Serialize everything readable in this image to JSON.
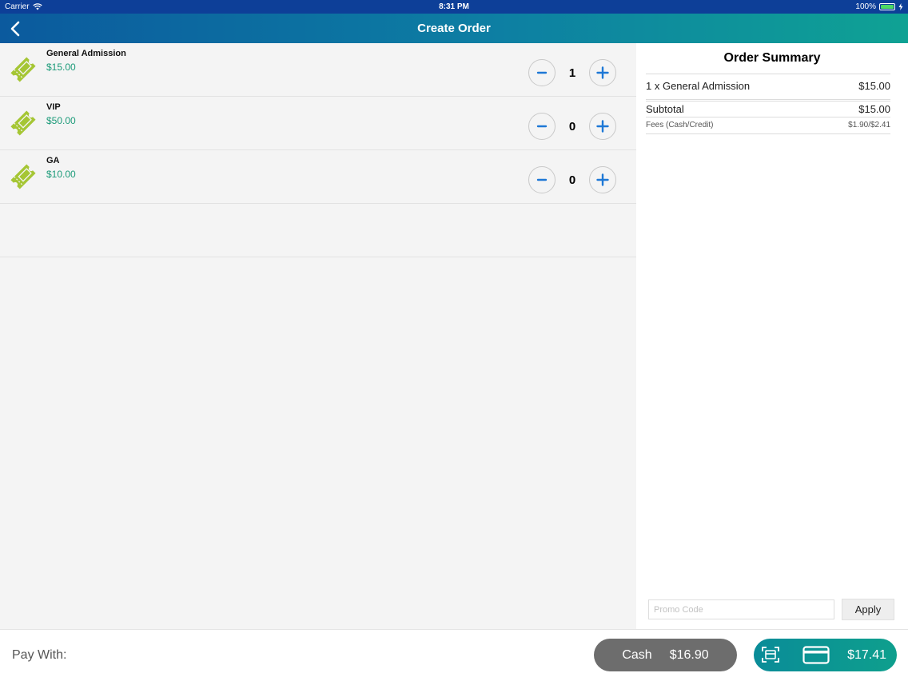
{
  "status_bar": {
    "carrier": "Carrier",
    "time": "8:31 PM",
    "battery": "100%"
  },
  "nav": {
    "title": "Create Order"
  },
  "tickets": [
    {
      "name": "General Admission",
      "price": "$15.00",
      "quantity": "1"
    },
    {
      "name": "VIP",
      "price": "$50.00",
      "quantity": "0"
    },
    {
      "name": "GA",
      "price": "$10.00",
      "quantity": "0"
    }
  ],
  "summary": {
    "title": "Order Summary",
    "items": [
      {
        "label": "1 x General Admission",
        "amount": "$15.00"
      }
    ],
    "subtotal_label": "Subtotal",
    "subtotal_amount": "$15.00",
    "fees_label": "Fees (Cash/Credit)",
    "fees_amount": "$1.90/$2.41",
    "promo_placeholder": "Promo Code",
    "apply_label": "Apply"
  },
  "pay": {
    "label": "Pay With:",
    "cash_label": "Cash",
    "cash_amount": "$16.90",
    "card_amount": "$17.41"
  },
  "colors": {
    "status_bar": "#0d3f98",
    "nav_gradient_start": "#0b5a9e",
    "nav_gradient_end": "#0fa294",
    "ticket_icon": "#a5c634",
    "price_text": "#1a9a78",
    "stepper_accent": "#1e78d6",
    "cash_button": "#6d6d6d",
    "card_button": "#0e9f8d"
  },
  "icons": {
    "back": "chevron-left-icon",
    "ticket": "ticket-icon",
    "minus": "minus-icon",
    "plus": "plus-icon",
    "scan": "scan-icon",
    "card": "credit-card-icon",
    "wifi": "wifi-icon",
    "battery": "battery-icon"
  }
}
